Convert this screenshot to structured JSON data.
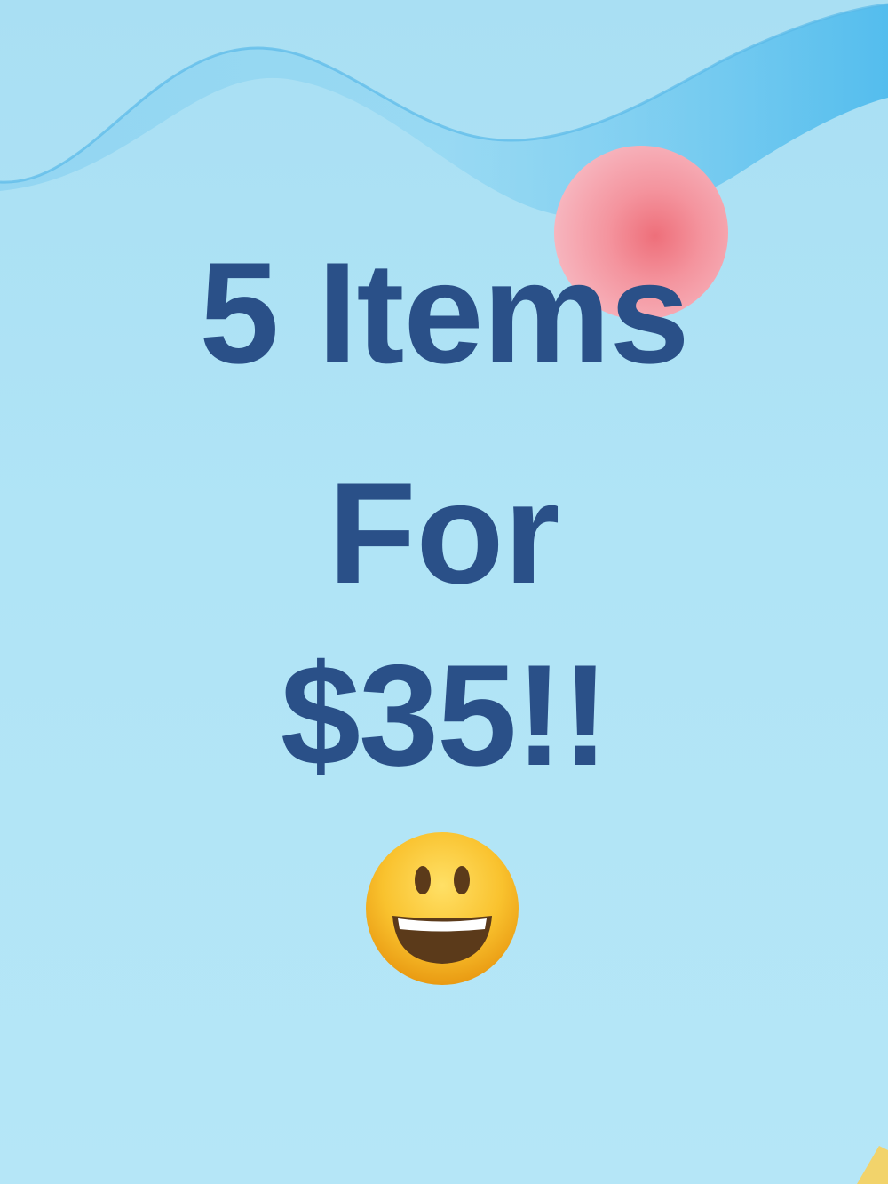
{
  "promo": {
    "line1": "5 Items",
    "line2": "For",
    "line3": "$35!!"
  },
  "icons": {
    "emoji": "smiley-face-icon"
  },
  "colors": {
    "background": "#b2e3f5",
    "text": "#2a5088",
    "ball": "#f08a96",
    "ribbon": "#5cc3ee",
    "emoji_face": "#f9c22e"
  }
}
